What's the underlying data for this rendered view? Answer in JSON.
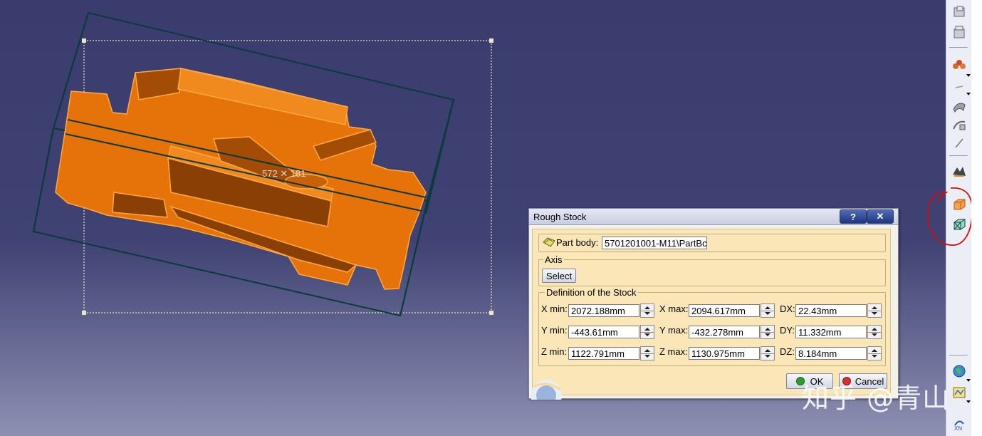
{
  "viewport": {
    "model_label": "572 ✕ 181",
    "annotation_color": "#cc1010",
    "part_color": "#e8780a",
    "background_color": "#3f4272"
  },
  "dialog": {
    "title": "Rough Stock",
    "help_label": "?",
    "close_label": "✕",
    "part_body_label": "Part body:",
    "part_body_value": "5701201001-M11\\PartBc",
    "axis_legend": "Axis",
    "select_label": "Select",
    "definition_legend": "Definition of the Stock",
    "fields": {
      "x_min_label": "X min:",
      "x_min_value": "2072.188mm",
      "x_max_label": "X max:",
      "x_max_value": "2094.617mm",
      "dx_label": "DX:",
      "dx_value": "22.43mm",
      "y_min_label": "Y min:",
      "y_min_value": "-443.61mm",
      "y_max_label": "Y max:",
      "y_max_value": "-432.278mm",
      "dy_label": "DY:",
      "dy_value": "11.332mm",
      "z_min_label": "Z min:",
      "z_min_value": "1122.791mm",
      "z_max_label": "Z max:",
      "z_max_value": "1130.975mm",
      "dz_label": "DZ:",
      "dz_value": "8.184mm"
    },
    "ok_label": "OK",
    "cancel_label": "Cancel"
  },
  "toolbar": {
    "icons": [
      "part-top-icon",
      "part-bottom-icon",
      "tool-cluster-icon",
      "surface-icon",
      "curve-icon",
      "wave-tool-icon",
      "rough-stock-icon",
      "stock-box-icon",
      "globe-icon",
      "map-icon",
      "axis-icon"
    ],
    "axis_label": "XN"
  },
  "watermark": "知乎 @青山"
}
